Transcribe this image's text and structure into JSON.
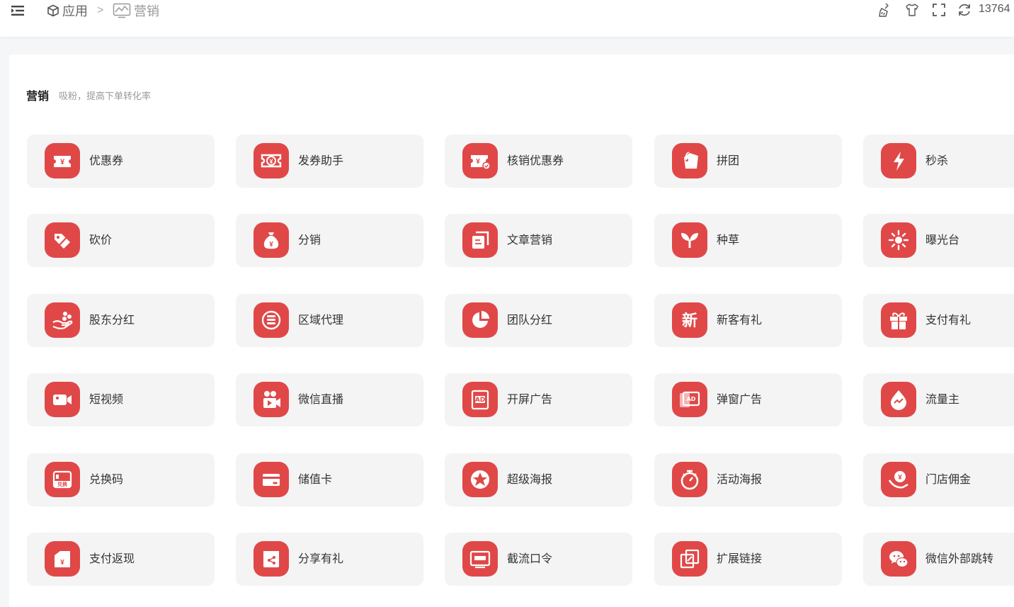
{
  "header": {
    "breadcrumb": [
      "应用",
      "营销"
    ],
    "separator": ">",
    "user": "13764",
    "tools": [
      "broom-icon",
      "tshirt-icon",
      "fullscreen-icon",
      "refresh-icon"
    ]
  },
  "section": {
    "title": "营销",
    "description": "吸粉，提高下单转化率"
  },
  "theme": {
    "accent": "#e04848",
    "card_bg": "#f4f4f5"
  },
  "apps": [
    {
      "label": "优惠券",
      "icon": "coupon-icon"
    },
    {
      "label": "发券助手",
      "icon": "coupon-assistant-icon"
    },
    {
      "label": "核销优惠券",
      "icon": "coupon-verify-icon"
    },
    {
      "label": "拼团",
      "icon": "group-buy-icon"
    },
    {
      "label": "秒杀",
      "icon": "flash-sale-icon"
    },
    {
      "label": "砍价",
      "icon": "bargain-icon"
    },
    {
      "label": "分销",
      "icon": "money-bag-icon"
    },
    {
      "label": "文章营销",
      "icon": "article-icon"
    },
    {
      "label": "种草",
      "icon": "sprout-icon"
    },
    {
      "label": "曝光台",
      "icon": "sun-icon"
    },
    {
      "label": "股东分红",
      "icon": "hand-coins-icon"
    },
    {
      "label": "区域代理",
      "icon": "coin-stack-icon"
    },
    {
      "label": "团队分红",
      "icon": "pie-chart-icon"
    },
    {
      "label": "新客有礼",
      "icon": "new-text-icon",
      "glyph": "新"
    },
    {
      "label": "支付有礼",
      "icon": "gift-icon"
    },
    {
      "label": "短视频",
      "icon": "video-camera-icon"
    },
    {
      "label": "微信直播",
      "icon": "live-stream-icon"
    },
    {
      "label": "开屏广告",
      "icon": "ad-screen-icon",
      "glyph": "AD"
    },
    {
      "label": "弹窗广告",
      "icon": "ad-popup-icon",
      "glyph": "AD"
    },
    {
      "label": "流量主",
      "icon": "water-drop-icon"
    },
    {
      "label": "兑换码",
      "icon": "redeem-code-icon",
      "glyph": "兑换"
    },
    {
      "label": "储值卡",
      "icon": "stored-card-icon"
    },
    {
      "label": "超级海报",
      "icon": "star-poster-icon"
    },
    {
      "label": "活动海报",
      "icon": "stopwatch-icon"
    },
    {
      "label": "门店佣金",
      "icon": "store-commission-icon"
    },
    {
      "label": "支付返现",
      "icon": "cashback-icon"
    },
    {
      "label": "分享有礼",
      "icon": "share-gift-icon"
    },
    {
      "label": "截流口令",
      "icon": "password-screen-icon"
    },
    {
      "label": "扩展链接",
      "icon": "link-icon"
    },
    {
      "label": "微信外部跳转",
      "icon": "wechat-icon"
    }
  ]
}
